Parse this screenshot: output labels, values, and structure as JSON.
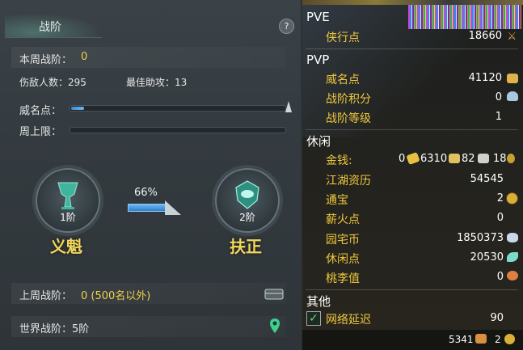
{
  "left": {
    "title": "战阶",
    "help": "?",
    "weekly_rank_label": "本周战阶：",
    "weekly_rank_value": "0",
    "kills_label": "伤敌人数：295",
    "best_assist_label": "最佳助攻：13",
    "prestige_label": "威名点：",
    "prestige_progress": 0.06,
    "weekly_cap_label": "周上限：",
    "weekly_cap_progress": 0.0,
    "emblem_left": {
      "level": "1阶",
      "name": "义魁"
    },
    "emblem_right": {
      "level": "2阶",
      "name": "扶正"
    },
    "ratio_text": "66%",
    "ratio_progress": 0.66,
    "last_week_label": "上周战阶：",
    "last_week_value": "0 (500名以外)",
    "world_rank_label": "世界战阶：5阶"
  },
  "right": {
    "pve_title": "PVE",
    "xiaxingdian_label": "侠行点",
    "xiaxingdian_value": "18660",
    "pvp_title": "PVP",
    "weiming_label": "威名点",
    "weiming_value": "41120",
    "zhanjie_score_label": "战阶积分",
    "zhanjie_score_value": "0",
    "zhanjie_level_label": "战阶等级",
    "zhanjie_level_value": "1",
    "leisure_title": "休闲",
    "money_label": "金钱:",
    "money_gold": "0",
    "money_silver": "6310",
    "money_copper": "82",
    "money_d": "18",
    "jianghu_label": "江湖资历",
    "jianghu_value": "54545",
    "tongbao_label": "通宝",
    "tongbao_value": "2",
    "xinhuo_label": "薪火点",
    "xinhuo_value": "0",
    "yuanzhai_label": "园宅币",
    "yuanzhai_value": "1850373",
    "xiuxian_label": "休闲点",
    "xiuxian_value": "20530",
    "taoli_label": "桃李值",
    "taoli_value": "0",
    "other_title": "其他",
    "latency_label": "网络延迟",
    "latency_value": "90",
    "bottom_a": "5341",
    "bottom_b": "2"
  }
}
